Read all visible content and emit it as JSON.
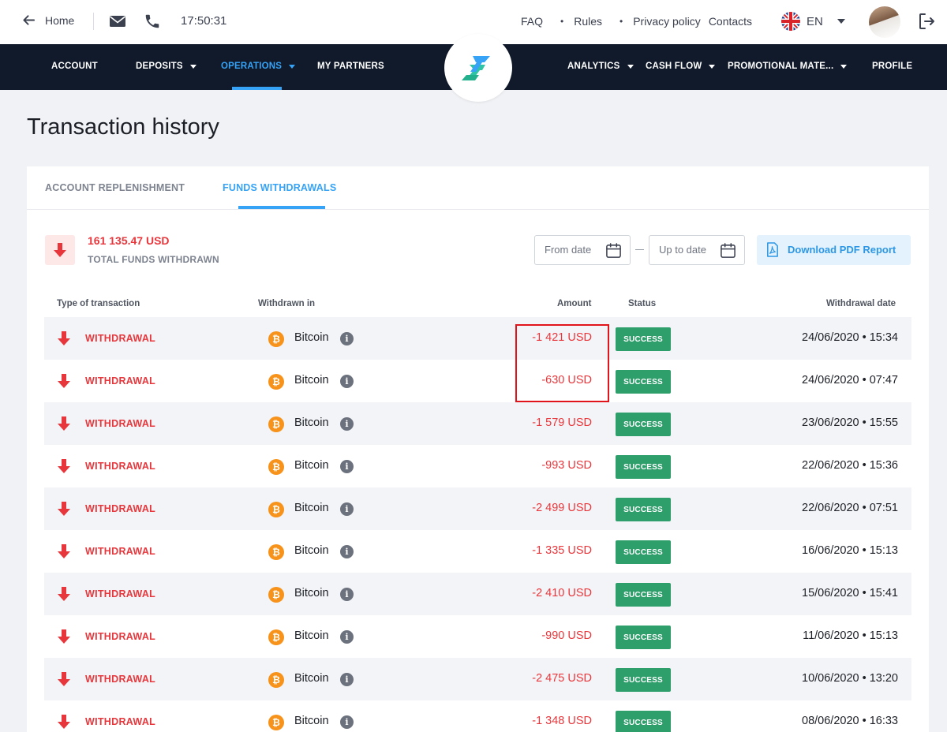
{
  "topbar": {
    "home_label": "Home",
    "time": "17:50:31",
    "links": [
      "FAQ",
      "Rules",
      "Privacy policy",
      "Contacts"
    ],
    "separator": "•",
    "language": "EN"
  },
  "nav": {
    "left": [
      {
        "label": "ACCOUNT",
        "has_dropdown": false,
        "active": false
      },
      {
        "label": "DEPOSITS",
        "has_dropdown": true,
        "active": false
      },
      {
        "label": "OPERATIONS",
        "has_dropdown": true,
        "active": true
      },
      {
        "label": "MY PARTNERS",
        "has_dropdown": false,
        "active": false
      }
    ],
    "right": [
      {
        "label": "ANALYTICS",
        "has_dropdown": true
      },
      {
        "label": "CASH FLOW",
        "has_dropdown": true
      },
      {
        "label": "PROMOTIONAL MATE...",
        "has_dropdown": true
      },
      {
        "label": "PROFILE",
        "has_dropdown": false
      }
    ]
  },
  "page": {
    "title": "Transaction history"
  },
  "tabs": [
    {
      "label": "ACCOUNT REPLENISHMENT",
      "active": false
    },
    {
      "label": "FUNDS WITHDRAWALS",
      "active": true
    }
  ],
  "summary": {
    "amount": "161 135.47 USD",
    "label": "TOTAL FUNDS WITHDRAWN"
  },
  "filters": {
    "from_placeholder": "From date",
    "to_placeholder": "Up to date",
    "download_label": "Download PDF Report"
  },
  "table": {
    "headers": {
      "type": "Type of transaction",
      "withdrawn_in": "Withdrawn in",
      "amount": "Amount",
      "status": "Status",
      "date": "Withdrawal date"
    },
    "rows": [
      {
        "type": "WITHDRAWAL",
        "wallet": "Bitcoin",
        "coin_symbol": "₿",
        "amount": "-1 421 USD",
        "status": "SUCCESS",
        "date": "24/06/2020 • 15:34"
      },
      {
        "type": "WITHDRAWAL",
        "wallet": "Bitcoin",
        "coin_symbol": "₿",
        "amount": "-630 USD",
        "status": "SUCCESS",
        "date": "24/06/2020 • 07:47"
      },
      {
        "type": "WITHDRAWAL",
        "wallet": "Bitcoin",
        "coin_symbol": "₿",
        "amount": "-1 579 USD",
        "status": "SUCCESS",
        "date": "23/06/2020 • 15:55"
      },
      {
        "type": "WITHDRAWAL",
        "wallet": "Bitcoin",
        "coin_symbol": "₿",
        "amount": "-993 USD",
        "status": "SUCCESS",
        "date": "22/06/2020 • 15:36"
      },
      {
        "type": "WITHDRAWAL",
        "wallet": "Bitcoin",
        "coin_symbol": "₿",
        "amount": "-2 499 USD",
        "status": "SUCCESS",
        "date": "22/06/2020 • 07:51"
      },
      {
        "type": "WITHDRAWAL",
        "wallet": "Bitcoin",
        "coin_symbol": "₿",
        "amount": "-1 335 USD",
        "status": "SUCCESS",
        "date": "16/06/2020 • 15:13"
      },
      {
        "type": "WITHDRAWAL",
        "wallet": "Bitcoin",
        "coin_symbol": "₿",
        "amount": "-2 410 USD",
        "status": "SUCCESS",
        "date": "15/06/2020 • 15:41"
      },
      {
        "type": "WITHDRAWAL",
        "wallet": "Bitcoin",
        "coin_symbol": "₿",
        "amount": "-990 USD",
        "status": "SUCCESS",
        "date": "11/06/2020 • 15:13"
      },
      {
        "type": "WITHDRAWAL",
        "wallet": "Bitcoin",
        "coin_symbol": "₿",
        "amount": "-2 475 USD",
        "status": "SUCCESS",
        "date": "10/06/2020 • 13:20"
      },
      {
        "type": "WITHDRAWAL",
        "wallet": "Bitcoin",
        "coin_symbol": "₿",
        "amount": "-1 348 USD",
        "status": "SUCCESS",
        "date": "08/06/2020 • 16:33"
      }
    ]
  },
  "colors": {
    "nav_bg": "#101a2b",
    "accent": "#36a3f7",
    "negative": "#e8373c",
    "success": "#2e9e6b",
    "page_bg": "#f1f2f5"
  },
  "icons": {
    "home": "arrow-left-icon",
    "mail": "envelope-icon",
    "phone": "phone-icon",
    "flag": "uk-flag-icon",
    "logout": "logout-icon",
    "date": "calendar-icon",
    "pdf": "pdf-file-icon",
    "withdrawal": "arrow-down-icon",
    "coin": "bitcoin-icon",
    "info": "info-icon"
  }
}
